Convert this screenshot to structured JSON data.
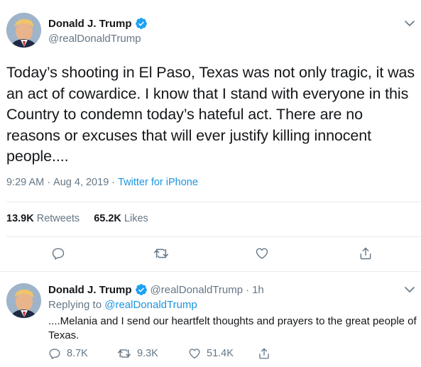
{
  "main_tweet": {
    "author": {
      "display_name": "Donald J. Trump",
      "handle": "@realDonaldTrump",
      "verified": true,
      "avatar_icon": "profile-photo-avatar"
    },
    "text": "Today’s shooting in El Paso, Texas was not only tragic, it was an act of cowardice. I know that I stand with everyone in this Country to condemn today’s hateful act. There are no reasons or excuses that will ever justify killing innocent people....",
    "time": "9:29 AM",
    "separator": "·",
    "date": "Aug 4, 2019",
    "source": "Twitter for iPhone",
    "stats": {
      "retweets_count": "13.9K",
      "retweets_label": "Retweets",
      "likes_count": "65.2K",
      "likes_label": "Likes"
    },
    "actions": [
      "reply-icon",
      "retweet-icon",
      "like-icon",
      "share-icon"
    ]
  },
  "reply_tweet": {
    "author": {
      "display_name": "Donald J. Trump",
      "handle": "@realDonaldTrump",
      "verified": true
    },
    "separator": "·",
    "age": "1h",
    "replying_label": "Replying to",
    "replying_to": "@realDonaldTrump",
    "text": "....Melania and I send our heartfelt thoughts and prayers to the great people of Texas.",
    "actions": {
      "replies": "8.7K",
      "retweets": "9.3K",
      "likes": "51.4K"
    }
  },
  "colors": {
    "accent": "#1b95e0",
    "secondary_text": "#657786",
    "primary_text": "#14171a",
    "divider": "#e6ecf0",
    "verified": "#1da1f2"
  }
}
